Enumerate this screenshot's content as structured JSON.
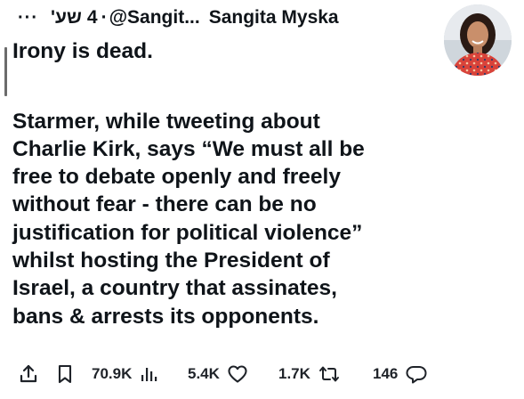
{
  "tweet": {
    "more_label": "···",
    "time_number": "4",
    "time_unit": "שע'",
    "separator": "·",
    "handle": "@Sangit...",
    "display_name": "Sangita Myska",
    "text_lines_1": [
      "Irony is dead."
    ],
    "text_lines_2": [
      "Starmer, while tweeting about",
      "Charlie Kirk, says “We must all be",
      "free to debate openly and freely",
      "without fear - there can be no",
      "justification for political violence”",
      "whilst hosting the President of",
      "Israel, a country that assinates,",
      "bans & arrests its opponents."
    ]
  },
  "actions": {
    "share_icon": "share-icon",
    "bookmark_icon": "bookmark-icon",
    "views": "70.9K",
    "views_icon": "views-icon",
    "likes": "5.4K",
    "like_icon": "heart-icon",
    "reposts": "1.7K",
    "repost_icon": "repost-icon",
    "replies": "146",
    "reply_icon": "reply-icon"
  },
  "colors": {
    "text": "#0f1419",
    "icon": "#1f2329",
    "background": "#ffffff"
  }
}
